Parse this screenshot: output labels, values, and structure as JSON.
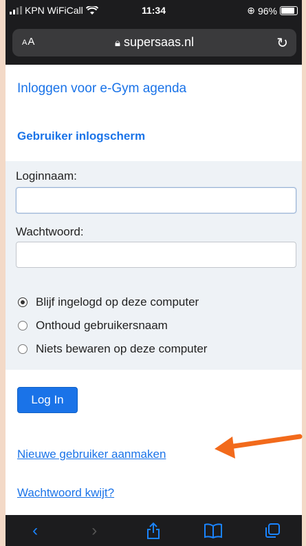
{
  "status": {
    "carrier": "KPN WiFiCall",
    "time": "11:34",
    "battery": "96%",
    "battery_level": 0.96
  },
  "browser": {
    "aa_label": "AA",
    "domain": "supersaas.nl"
  },
  "page": {
    "title": "Inloggen voor e-Gym agenda",
    "section_title": "Gebruiker inlogscherm",
    "login_label": "Loginnaam:",
    "login_value": "",
    "password_label": "Wachtwoord:",
    "password_value": "",
    "options": [
      {
        "label": "Blijf ingelogd op deze computer",
        "checked": true
      },
      {
        "label": "Onthoud gebruikersnaam",
        "checked": false
      },
      {
        "label": "Niets bewaren op deze computer",
        "checked": false
      }
    ],
    "login_button": "Log In",
    "new_user_link": "Nieuwe gebruiker aanmaken",
    "forgot_link": "Wachtwoord kwijt?"
  },
  "colors": {
    "accent": "#1a73e8",
    "arrow": "#f26a1b"
  },
  "toolbar": {
    "icons": [
      "back-icon",
      "forward-icon",
      "share-icon",
      "bookmarks-icon",
      "tabs-icon"
    ]
  }
}
